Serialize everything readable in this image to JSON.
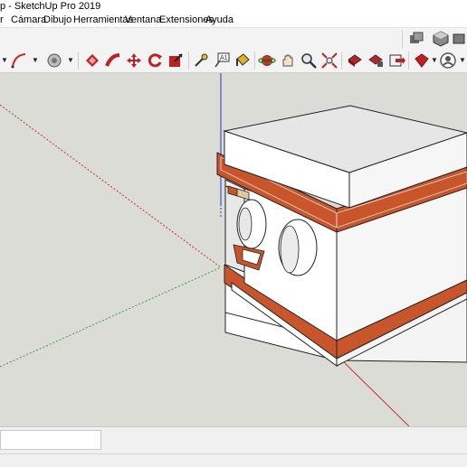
{
  "window": {
    "title": "p - SketchUp Pro 2019"
  },
  "menu": {
    "items": [
      "r",
      "Cámara",
      "Dibujo",
      "Herramientas",
      "Ventana",
      "Extensiones",
      "Ayuda"
    ]
  },
  "toolbar": {
    "top_icons": [
      "standard-views-icon",
      "iso-view-icon",
      "parallel-projection-icon",
      "perspective-icon"
    ],
    "main_icons": [
      "arc-icon",
      "paint-bucket-icon",
      "push-pull-icon",
      "follow-me-icon",
      "move-icon",
      "rotate-icon",
      "scale-icon",
      "tape-measure-icon",
      "text-icon",
      "paint-icon",
      "orbit-icon",
      "pan-icon",
      "zoom-icon",
      "zoom-extents-icon",
      "warehouse-icon",
      "extension-warehouse-icon",
      "send-to-layout-icon",
      "ruby-icon",
      "user-account-icon"
    ]
  },
  "viewport": {
    "background_color": "#dcdcd6",
    "box_top_color": "#e6e6e6",
    "box_side_color": "#ffffff",
    "band_color": "#c9552c",
    "axis_red": "#c0392b",
    "axis_green": "#3c9a3c",
    "axis_blue": "#2233cc"
  },
  "statusbar": {
    "measurements_value": ""
  }
}
